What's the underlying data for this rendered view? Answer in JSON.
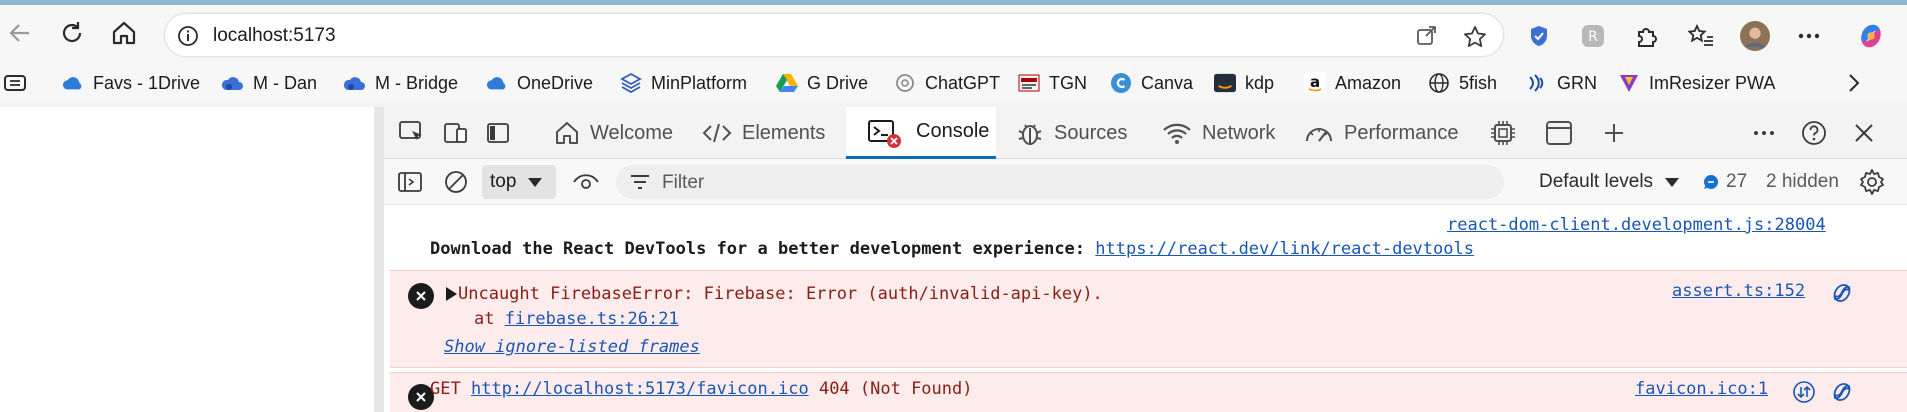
{
  "browser": {
    "url": "localhost:5173",
    "bookmarks": [
      {
        "label": "Favs - 1Drive",
        "icon": "onedrive-cloud-icon"
      },
      {
        "label": "M - Dan",
        "icon": "cloud-app-icon"
      },
      {
        "label": "M - Bridge",
        "icon": "cloud-app-icon"
      },
      {
        "label": "OneDrive",
        "icon": "onedrive-cloud-icon"
      },
      {
        "label": "MinPlatform",
        "icon": "layers-icon"
      },
      {
        "label": "G Drive",
        "icon": "google-drive-icon"
      },
      {
        "label": "ChatGPT",
        "icon": "chatgpt-icon"
      },
      {
        "label": "TGN",
        "icon": "tgn-icon"
      },
      {
        "label": "Canva",
        "icon": "canva-icon"
      },
      {
        "label": "kdp",
        "icon": "amazon-kdp-icon"
      },
      {
        "label": "Amazon",
        "icon": "amazon-icon"
      },
      {
        "label": "5fish",
        "icon": "globe-icon"
      },
      {
        "label": "GRN",
        "icon": "grn-icon"
      },
      {
        "label": "ImResizer PWA",
        "icon": "imresizer-icon"
      }
    ]
  },
  "devtools": {
    "tabs": [
      {
        "label": "Welcome",
        "icon": "home-icon"
      },
      {
        "label": "Elements",
        "icon": "code-icon"
      },
      {
        "label": "Console",
        "icon": "console-icon"
      },
      {
        "label": "Sources",
        "icon": "bug-icon"
      },
      {
        "label": "Network",
        "icon": "wifi-icon"
      },
      {
        "label": "Performance",
        "icon": "gauge-icon"
      }
    ],
    "toolbar": {
      "context": "top",
      "filter_placeholder": "Filter",
      "levels": "Default levels",
      "issues_count": "27",
      "hidden": "2 hidden"
    },
    "console": {
      "info_source": "react-dom-client.development.js:28004",
      "info_text": "Download the React DevTools for a better development experience: ",
      "info_link": "https://react.dev/link/react-devtools",
      "error1_text": "Uncaught FirebaseError: Firebase: Error (auth/invalid-api-key).",
      "error1_at": "at ",
      "error1_at_link": "firebase.ts:26:21",
      "error1_show": "Show ignore-listed frames",
      "error1_source": "assert.ts:152",
      "error2_method": "GET ",
      "error2_url": "http://localhost:5173/favicon.ico",
      "error2_status": " 404 (Not Found)",
      "error2_source": "favicon.ico:1"
    }
  },
  "colors": {
    "accent": "#0f6cbd",
    "error_bg": "#fdeceb",
    "link": "#1a56b5"
  }
}
